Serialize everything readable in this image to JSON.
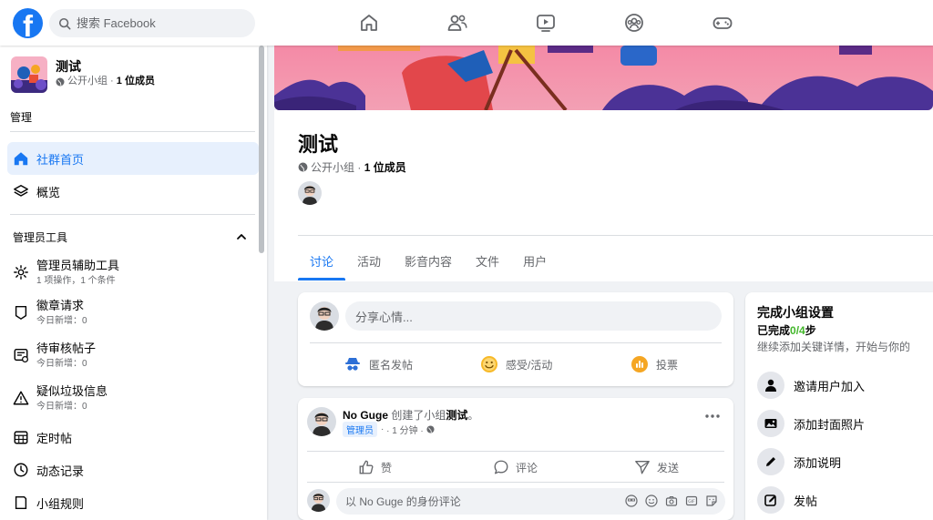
{
  "topbar": {
    "logo_letter": "f",
    "search_placeholder": "搜索 Facebook",
    "nav_icons": [
      "home-icon",
      "friends-icon",
      "watch-icon",
      "groups-icon",
      "gaming-icon"
    ]
  },
  "sidebar": {
    "group_name": "测试",
    "group_privacy": "公开小组",
    "group_members": "1 位成员",
    "manage_label": "管理",
    "items": [
      {
        "label": "社群首页",
        "icon": "home-icon",
        "active": true
      },
      {
        "label": "概览",
        "icon": "layers-icon",
        "active": false
      }
    ],
    "admin_tools_title": "管理员工具",
    "admin_items": [
      {
        "label": "管理员辅助工具",
        "sub": "1 项操作，1 个条件",
        "icon": "gear-icon"
      },
      {
        "label": "徽章请求",
        "sub": "今日新增：0",
        "icon": "badge-icon"
      },
      {
        "label": "待审核帖子",
        "sub": "今日新增：0",
        "icon": "pending-posts-icon"
      },
      {
        "label": "疑似垃圾信息",
        "sub": "今日新增：0",
        "icon": "warning-icon"
      }
    ],
    "plain_items": [
      {
        "label": "定时帖",
        "icon": "calendar-icon"
      },
      {
        "label": "动态记录",
        "icon": "clock-icon"
      },
      {
        "label": "小组规则",
        "icon": "rules-icon"
      }
    ]
  },
  "header": {
    "title": "测试",
    "privacy": "公开小组",
    "members": "1 位成员",
    "tabs": [
      "讨论",
      "活动",
      "影音内容",
      "文件",
      "用户"
    ],
    "active_tab": "讨论"
  },
  "composer": {
    "placeholder": "分享心情...",
    "actions": [
      {
        "label": "匿名发帖",
        "icon": "anonymous-icon"
      },
      {
        "label": "感受/活动",
        "icon": "feeling-icon"
      },
      {
        "label": "投票",
        "icon": "poll-icon"
      }
    ]
  },
  "post": {
    "author": "No Guge",
    "action_text": "创建了小组",
    "group": "测试",
    "period": "。",
    "badge": "管理员",
    "dot": "·",
    "time": "· 1 分钟 ·",
    "actions": [
      "赞",
      "评论",
      "发送"
    ],
    "comment_placeholder": "以 No Guge 的身份评论"
  },
  "setup": {
    "title": "完成小组设置",
    "progress_prefix": "已完成",
    "progress_value": "0/4",
    "progress_suffix": "步",
    "desc": "继续添加关键详情，开始与你的",
    "items": [
      {
        "label": "邀请用户加入",
        "icon": "person-icon"
      },
      {
        "label": "添加封面照片",
        "icon": "photo-icon"
      },
      {
        "label": "添加说明",
        "icon": "pencil-icon"
      },
      {
        "label": "发帖",
        "icon": "compose-icon"
      }
    ]
  },
  "colors": {
    "accent": "#1877f2",
    "page_bg": "#f0f2f5",
    "progress_green": "#42b72a"
  }
}
